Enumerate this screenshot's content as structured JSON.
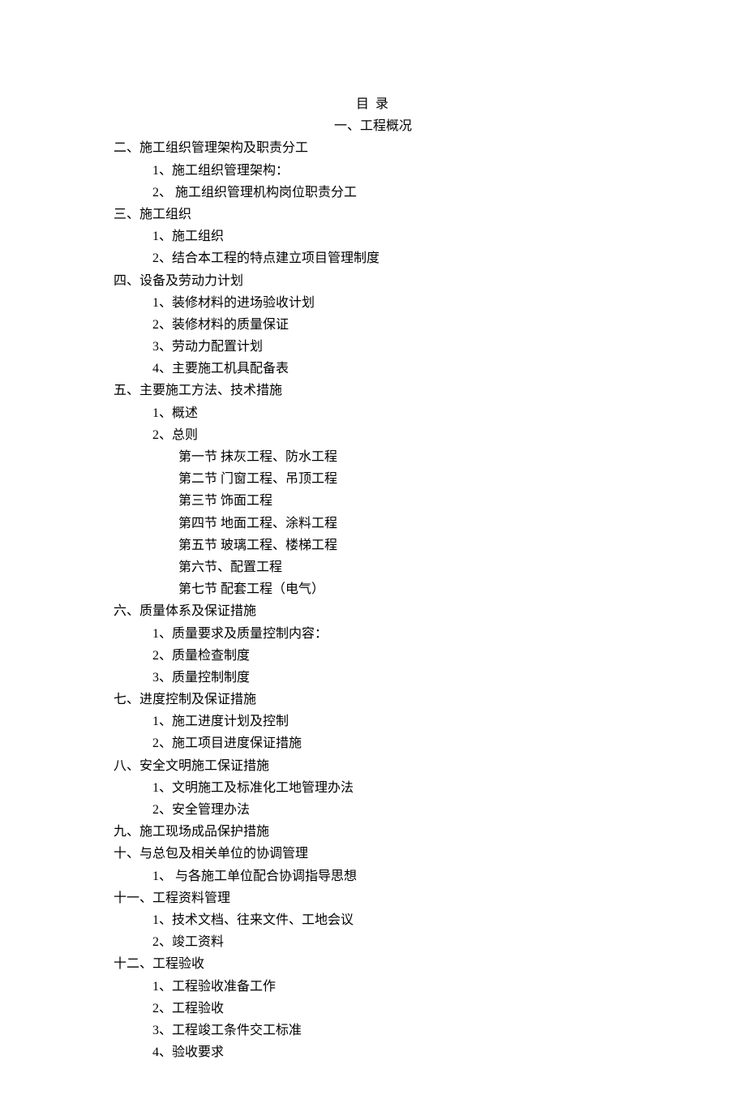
{
  "title": "目 录",
  "section1": "一、工程概况",
  "items": [
    {
      "cls": "level1",
      "text": "二、施工组织管理架构及职责分工"
    },
    {
      "cls": "level2",
      "text": "1、施工组织管理架构："
    },
    {
      "cls": "level2",
      "text": "2、  施工组织管理机构岗位职责分工"
    },
    {
      "cls": "level1",
      "text": "三、施工组织"
    },
    {
      "cls": "level2",
      "text": "1、施工组织"
    },
    {
      "cls": "level2",
      "text": "2、结合本工程的特点建立项目管理制度"
    },
    {
      "cls": "level1",
      "text": "四、设备及劳动力计划"
    },
    {
      "cls": "level2",
      "text": "1、装修材料的进场验收计划"
    },
    {
      "cls": "level2",
      "text": "2、装修材料的质量保证"
    },
    {
      "cls": "level2",
      "text": "3、劳动力配置计划"
    },
    {
      "cls": "level2",
      "text": "4、主要施工机具配备表"
    },
    {
      "cls": "level1",
      "text": "五、主要施工方法、技术措施"
    },
    {
      "cls": "level2",
      "text": "1、概述"
    },
    {
      "cls": "level2",
      "text": "2、总则"
    },
    {
      "cls": "level3",
      "text": "第一节  抹灰工程、防水工程"
    },
    {
      "cls": "level3",
      "text": "第二节  门窗工程、吊顶工程"
    },
    {
      "cls": "level3",
      "text": "第三节  饰面工程"
    },
    {
      "cls": "level3",
      "text": "第四节  地面工程、涂料工程"
    },
    {
      "cls": "level3",
      "text": "第五节  玻璃工程、楼梯工程"
    },
    {
      "cls": "level3",
      "text": "第六节、配置工程"
    },
    {
      "cls": "level3",
      "text": "第七节  配套工程（电气）"
    },
    {
      "cls": "level1",
      "text": "六、质量体系及保证措施"
    },
    {
      "cls": "level2",
      "text": "1、质量要求及质量控制内容："
    },
    {
      "cls": "level2",
      "text": "2、质量检查制度"
    },
    {
      "cls": "level2",
      "text": "3、质量控制制度"
    },
    {
      "cls": "level1",
      "text": "七、进度控制及保证措施"
    },
    {
      "cls": "level2",
      "text": "1、施工进度计划及控制"
    },
    {
      "cls": "level2",
      "text": "2、施工项目进度保证措施"
    },
    {
      "cls": "level1",
      "text": "八、安全文明施工保证措施"
    },
    {
      "cls": "level2",
      "text": "1、文明施工及标准化工地管理办法"
    },
    {
      "cls": "level2",
      "text": "2、安全管理办法"
    },
    {
      "cls": "level1",
      "text": "九、施工现场成品保护措施"
    },
    {
      "cls": "level1",
      "text": "十、与总包及相关单位的协调管理"
    },
    {
      "cls": "level2",
      "text": "1、  与各施工单位配合协调指导思想"
    },
    {
      "cls": "level1",
      "text": "十一、工程资料管理"
    },
    {
      "cls": "level2",
      "text": "1、技术文档、往来文件、工地会议"
    },
    {
      "cls": "level2",
      "text": "2、竣工资料"
    },
    {
      "cls": "level1",
      "text": "十二、工程验收"
    },
    {
      "cls": "level2",
      "text": "1、工程验收准备工作"
    },
    {
      "cls": "level2",
      "text": "2、工程验收"
    },
    {
      "cls": "level2",
      "text": "3、工程竣工条件交工标准"
    },
    {
      "cls": "level2",
      "text": "4、验收要求"
    }
  ]
}
